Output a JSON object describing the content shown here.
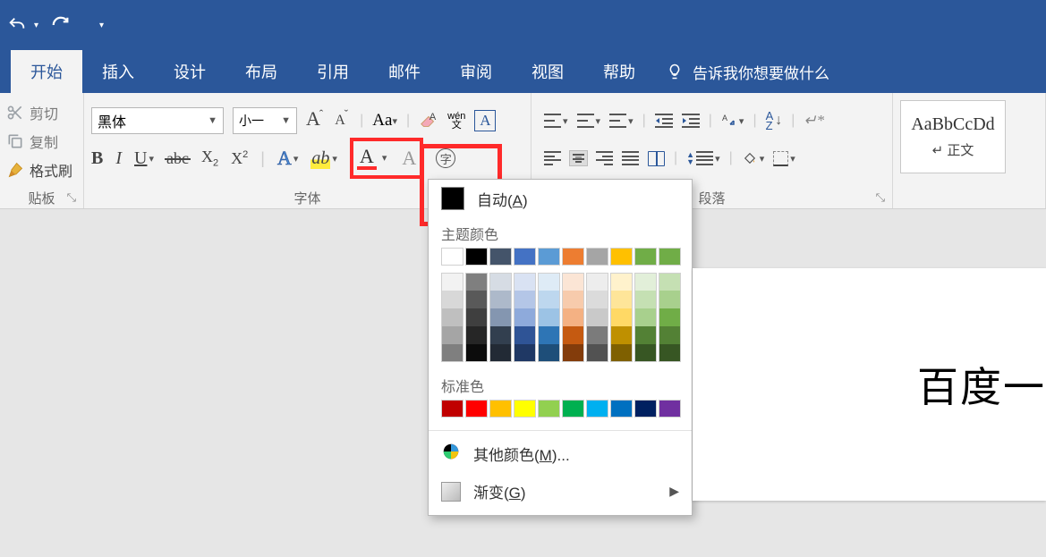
{
  "qat": {
    "undo_tip": "撤销",
    "redo_tip": "重做"
  },
  "tabs": {
    "home": "开始",
    "insert": "插入",
    "design": "设计",
    "layout": "布局",
    "references": "引用",
    "mail": "邮件",
    "review": "审阅",
    "view": "视图",
    "help": "帮助",
    "tell": "告诉我你想要做什么"
  },
  "clipboard": {
    "cut": "剪切",
    "copy": "复制",
    "format_painter": "格式刷",
    "label": "贴板"
  },
  "font": {
    "name": "黑体",
    "size": "小一",
    "label": "字体"
  },
  "paragraph": {
    "label": "段落"
  },
  "styles": {
    "preview": "AaBbCcDd",
    "name": "↵ 正文"
  },
  "color_popup": {
    "auto": "自动",
    "auto_key": "A",
    "theme_title": "主题颜色",
    "standard_title": "标准色",
    "more": "其他颜色",
    "more_key": "M",
    "gradient": "渐变",
    "gradient_key": "G",
    "theme_row": [
      "#ffffff",
      "#000000",
      "#44546a",
      "#4472c4",
      "#5b9bd5",
      "#ed7d31",
      "#a5a5a5",
      "#ffc000",
      "#70ad47",
      "#70ad47"
    ],
    "theme_shades": [
      [
        "#f2f2f2",
        "#7f7f7f",
        "#d6dce4",
        "#d9e2f3",
        "#deebf6",
        "#fbe5d5",
        "#ededed",
        "#fff2cc",
        "#e2efd9",
        "#c5e0b3"
      ],
      [
        "#d8d8d8",
        "#595959",
        "#adb9ca",
        "#b4c6e7",
        "#bdd7ee",
        "#f7cbac",
        "#dbdbdb",
        "#fee599",
        "#c5e0b3",
        "#a8d08d"
      ],
      [
        "#bfbfbf",
        "#3f3f3f",
        "#8496b0",
        "#8eaadb",
        "#9cc3e5",
        "#f4b183",
        "#c9c9c9",
        "#ffd965",
        "#a8d08d",
        "#70ad47"
      ],
      [
        "#a5a5a5",
        "#262626",
        "#323f4f",
        "#2f5496",
        "#2e75b5",
        "#c55a11",
        "#7b7b7b",
        "#bf9000",
        "#538135",
        "#538135"
      ],
      [
        "#7f7f7f",
        "#0c0c0c",
        "#222a35",
        "#1f3864",
        "#1e4e79",
        "#833c0b",
        "#525252",
        "#7f6000",
        "#375623",
        "#375623"
      ]
    ],
    "standard": [
      "#c00000",
      "#ff0000",
      "#ffc000",
      "#ffff00",
      "#92d050",
      "#00b050",
      "#00b0f0",
      "#0070c0",
      "#002060",
      "#7030a0"
    ]
  },
  "document": {
    "visible_text": "百度一"
  }
}
